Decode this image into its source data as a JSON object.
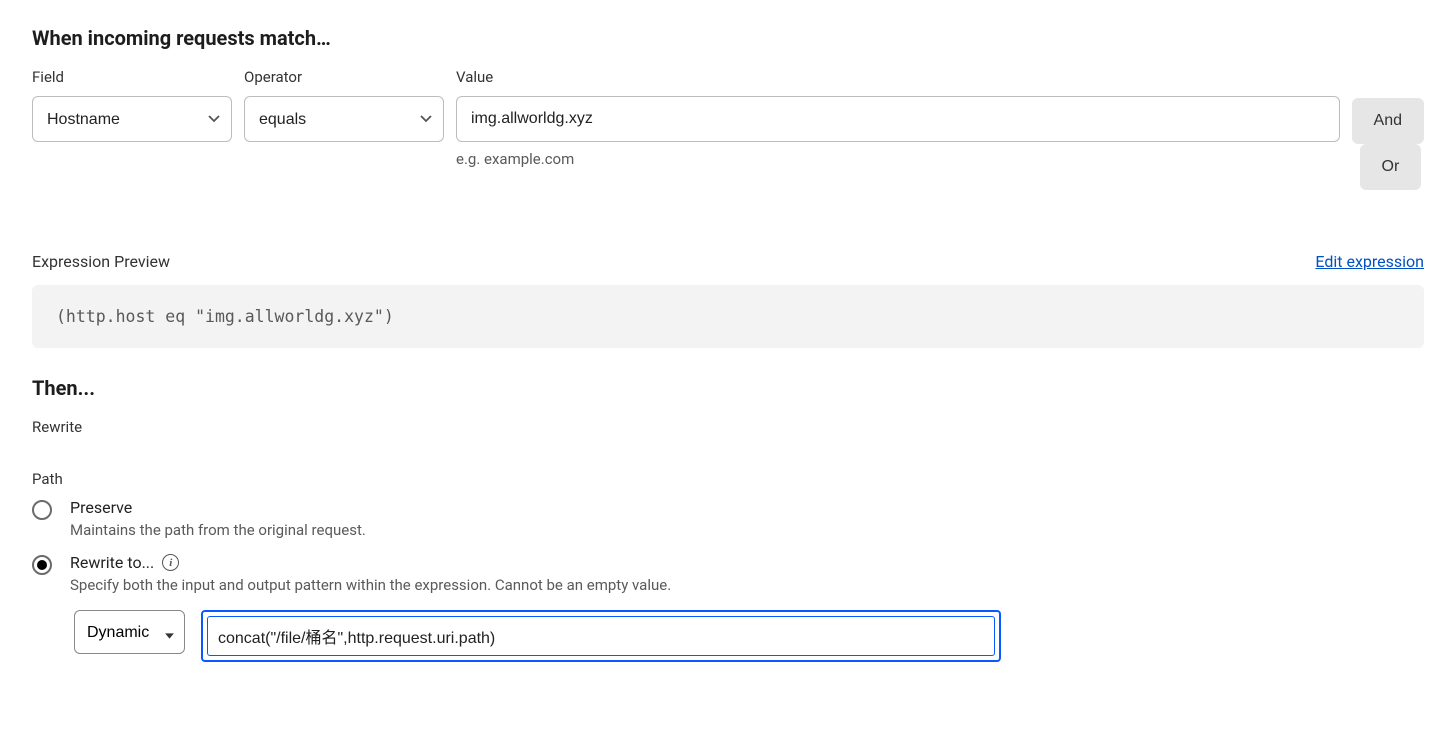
{
  "sections": {
    "match_title": "When incoming requests match…",
    "then_title": "Then...",
    "rewrite_label": "Rewrite",
    "path_label": "Path"
  },
  "columns": {
    "field_label": "Field",
    "operator_label": "Operator",
    "value_label": "Value"
  },
  "rule": {
    "field_selected": "Hostname",
    "operator_selected": "equals",
    "value": "img.allworldg.xyz",
    "value_hint": "e.g. example.com"
  },
  "buttons": {
    "and": "And",
    "or": "Or"
  },
  "preview": {
    "label": "Expression Preview",
    "edit_link": "Edit expression",
    "expression": "(http.host eq \"img.allworldg.xyz\")"
  },
  "path_options": {
    "preserve": {
      "title": "Preserve",
      "desc": "Maintains the path from the original request."
    },
    "rewrite": {
      "title": "Rewrite to...",
      "desc": "Specify both the input and output pattern within the expression. Cannot be an empty value."
    }
  },
  "rewrite_input": {
    "mode_selected": "Dynamic",
    "value": "concat(\"/file/桶名\",http.request.uri.path)"
  }
}
